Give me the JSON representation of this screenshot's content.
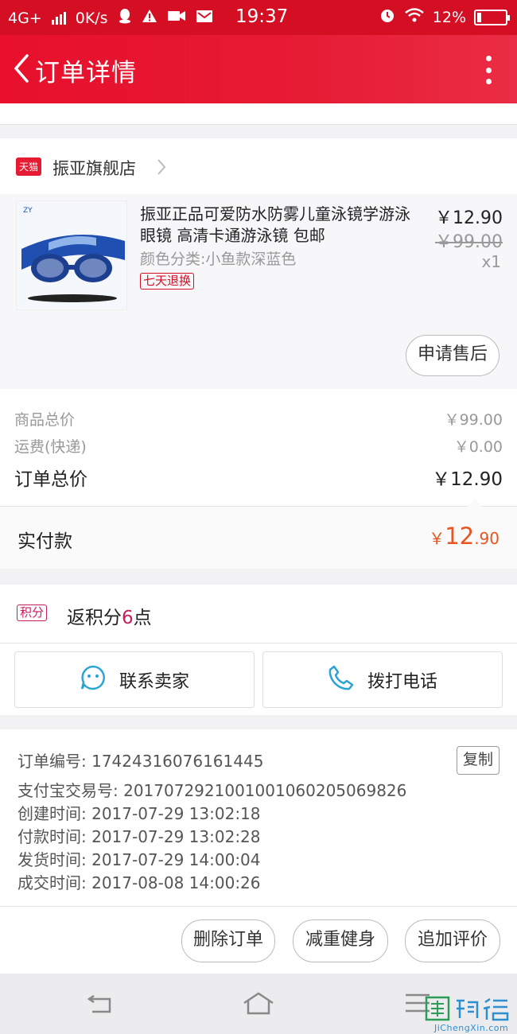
{
  "status_bar": {
    "network": "4G+",
    "speed": "0K/s",
    "time": "19:37",
    "battery": "12%"
  },
  "nav": {
    "title": "订单详情"
  },
  "store": {
    "badge": "天猫",
    "name": "振亚旗舰店"
  },
  "product": {
    "title": "振亚正品可爱防水防雾儿童泳镜学游泳眼镜 高清卡通游泳镜 包邮",
    "variant": "颜色分类:小鱼款深蓝色",
    "tag": "七天退换",
    "price": "￥12.90",
    "original_price": "￥99.00",
    "quantity": "x1",
    "after_sale_button": "申请售后"
  },
  "summary": {
    "goods_total_label": "商品总价",
    "goods_total_value": "￥99.00",
    "shipping_label": "运费(快递)",
    "shipping_value": "￥0.00",
    "order_total_label": "订单总价",
    "order_total_value": "￥12.90"
  },
  "payment": {
    "label": "实付款",
    "currency": "￥",
    "integer": "12",
    "decimal": ".90"
  },
  "points": {
    "badge": "积分",
    "text_prefix": "返积分",
    "count": "6",
    "text_suffix": "点"
  },
  "contact": {
    "seller_button": "联系卖家",
    "phone_button": "拨打电话"
  },
  "order_info": {
    "order_no": "订单编号: 17424316076161445",
    "copy_button": "复制",
    "alipay_no": "支付宝交易号: 2017072921001001060205069826",
    "created": "创建时间: 2017-07-29 13:02:18",
    "paid": "付款时间: 2017-07-29 13:02:28",
    "shipped": "发货时间: 2017-07-29 14:00:04",
    "completed": "成交时间: 2017-08-08 14:00:26"
  },
  "actions": {
    "delete": "删除订单",
    "fitness": "减重健身",
    "review": "追加评价"
  },
  "watermark": {
    "brand": "集诚信",
    "site": "JiChengXin.com"
  },
  "colors": {
    "brand_red": "#e61a33",
    "price_orange": "#e8541e",
    "points_pink": "#c71d5b",
    "icon_blue": "#2aa3d6"
  }
}
